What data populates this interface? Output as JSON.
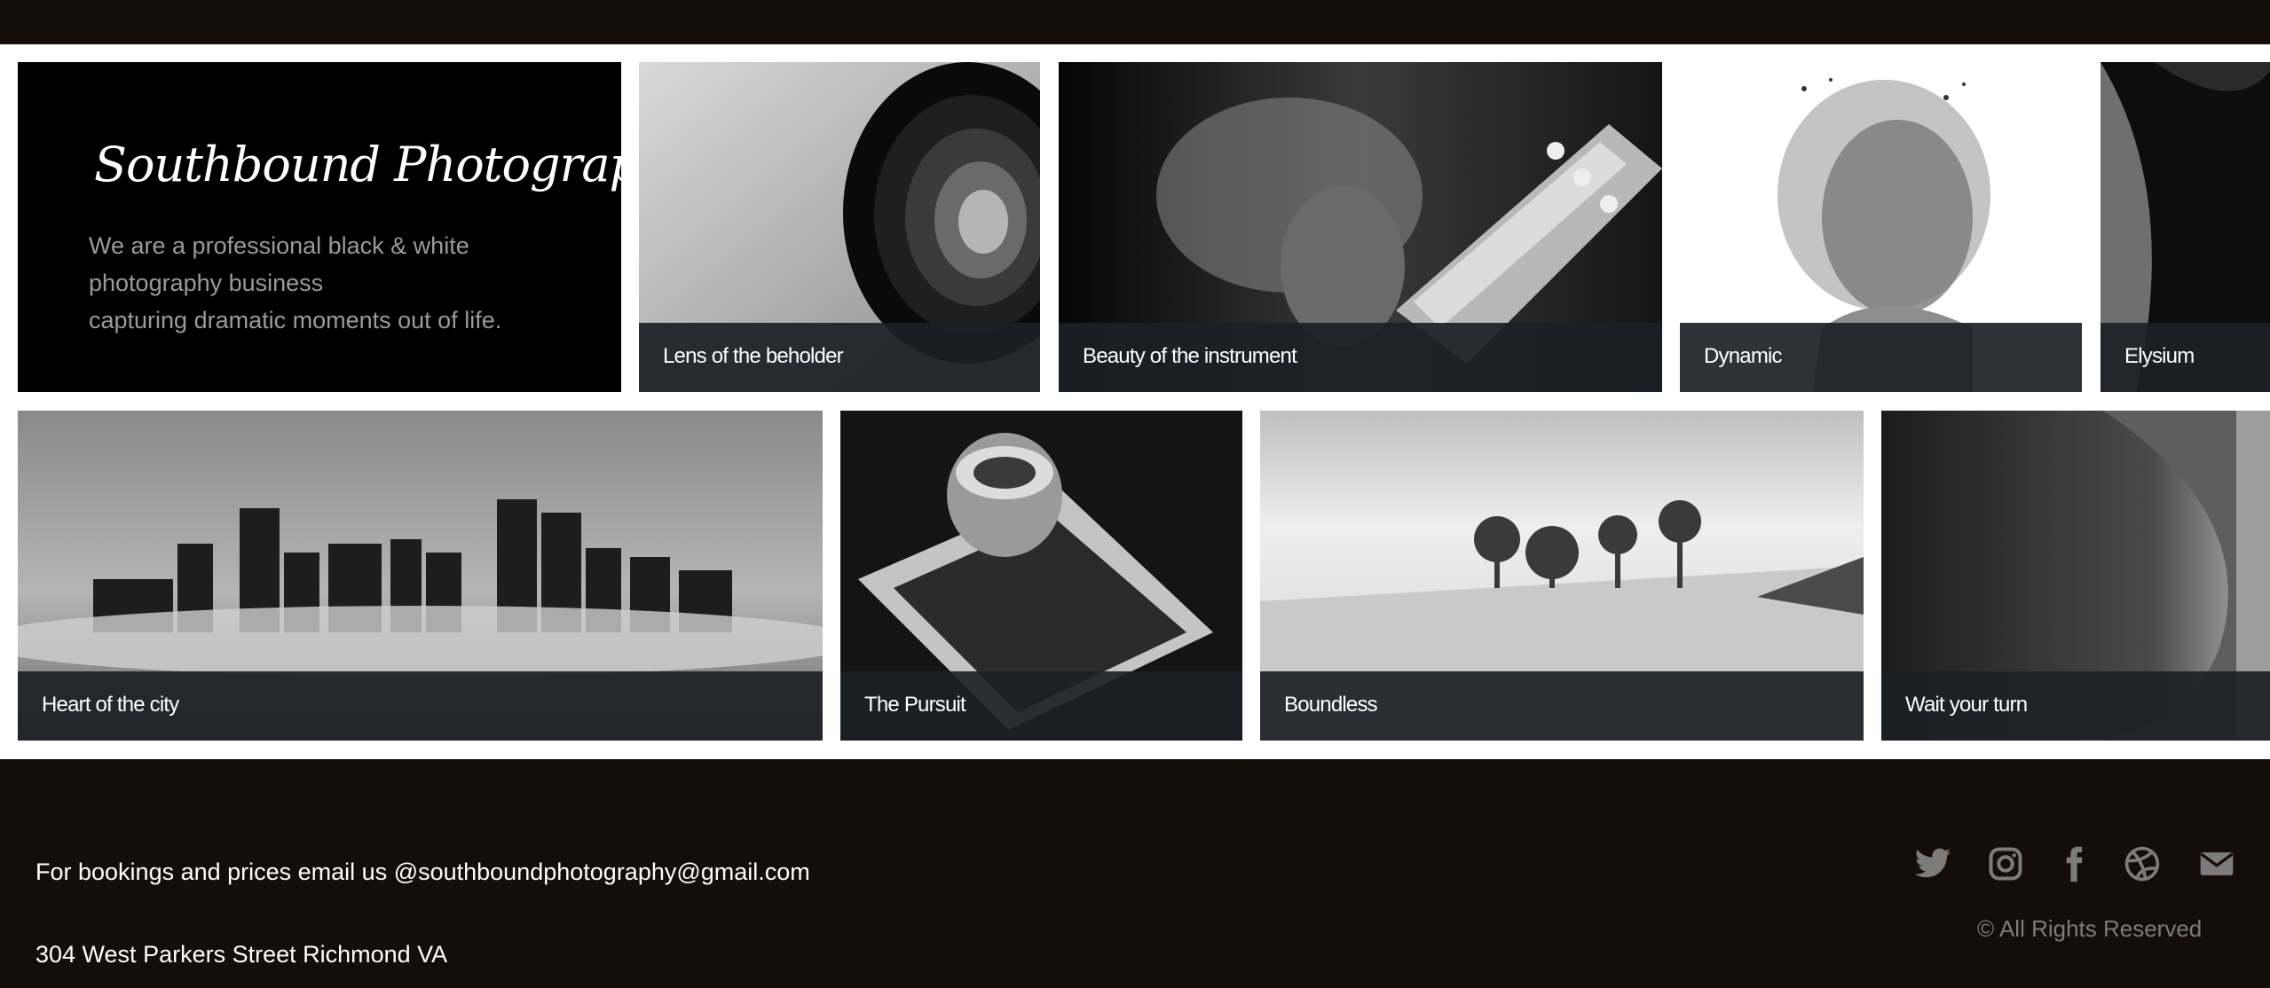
{
  "intro": {
    "title": "Southbound Photography",
    "line1": "We are a professional black & white",
    "line2": "photography business",
    "line3": "capturing dramatic moments out of life."
  },
  "gallery": {
    "row1": [
      {
        "caption": "Lens of the beholder"
      },
      {
        "caption": "Beauty of the instrument"
      },
      {
        "caption": "Dynamic"
      },
      {
        "caption": "Elysium"
      }
    ],
    "row2": [
      {
        "caption": "Heart of the city"
      },
      {
        "caption": "The Pursuit"
      },
      {
        "caption": "Boundless"
      },
      {
        "caption": "Wait your turn"
      }
    ]
  },
  "footer": {
    "booking": "For bookings and prices email us @southboundphotography@gmail.com",
    "address": "304 West Parkers Street Richmond VA",
    "rights": "© All Rights Reserved",
    "social_icons": [
      "twitter-icon",
      "instagram-icon",
      "facebook-icon",
      "dribbble-icon",
      "email-icon"
    ]
  },
  "colors": {
    "background": "#140d0a",
    "caption_bar": "#1c1f26",
    "intro_text": "#9a9a9a",
    "icon_color": "#7c7c7c"
  }
}
